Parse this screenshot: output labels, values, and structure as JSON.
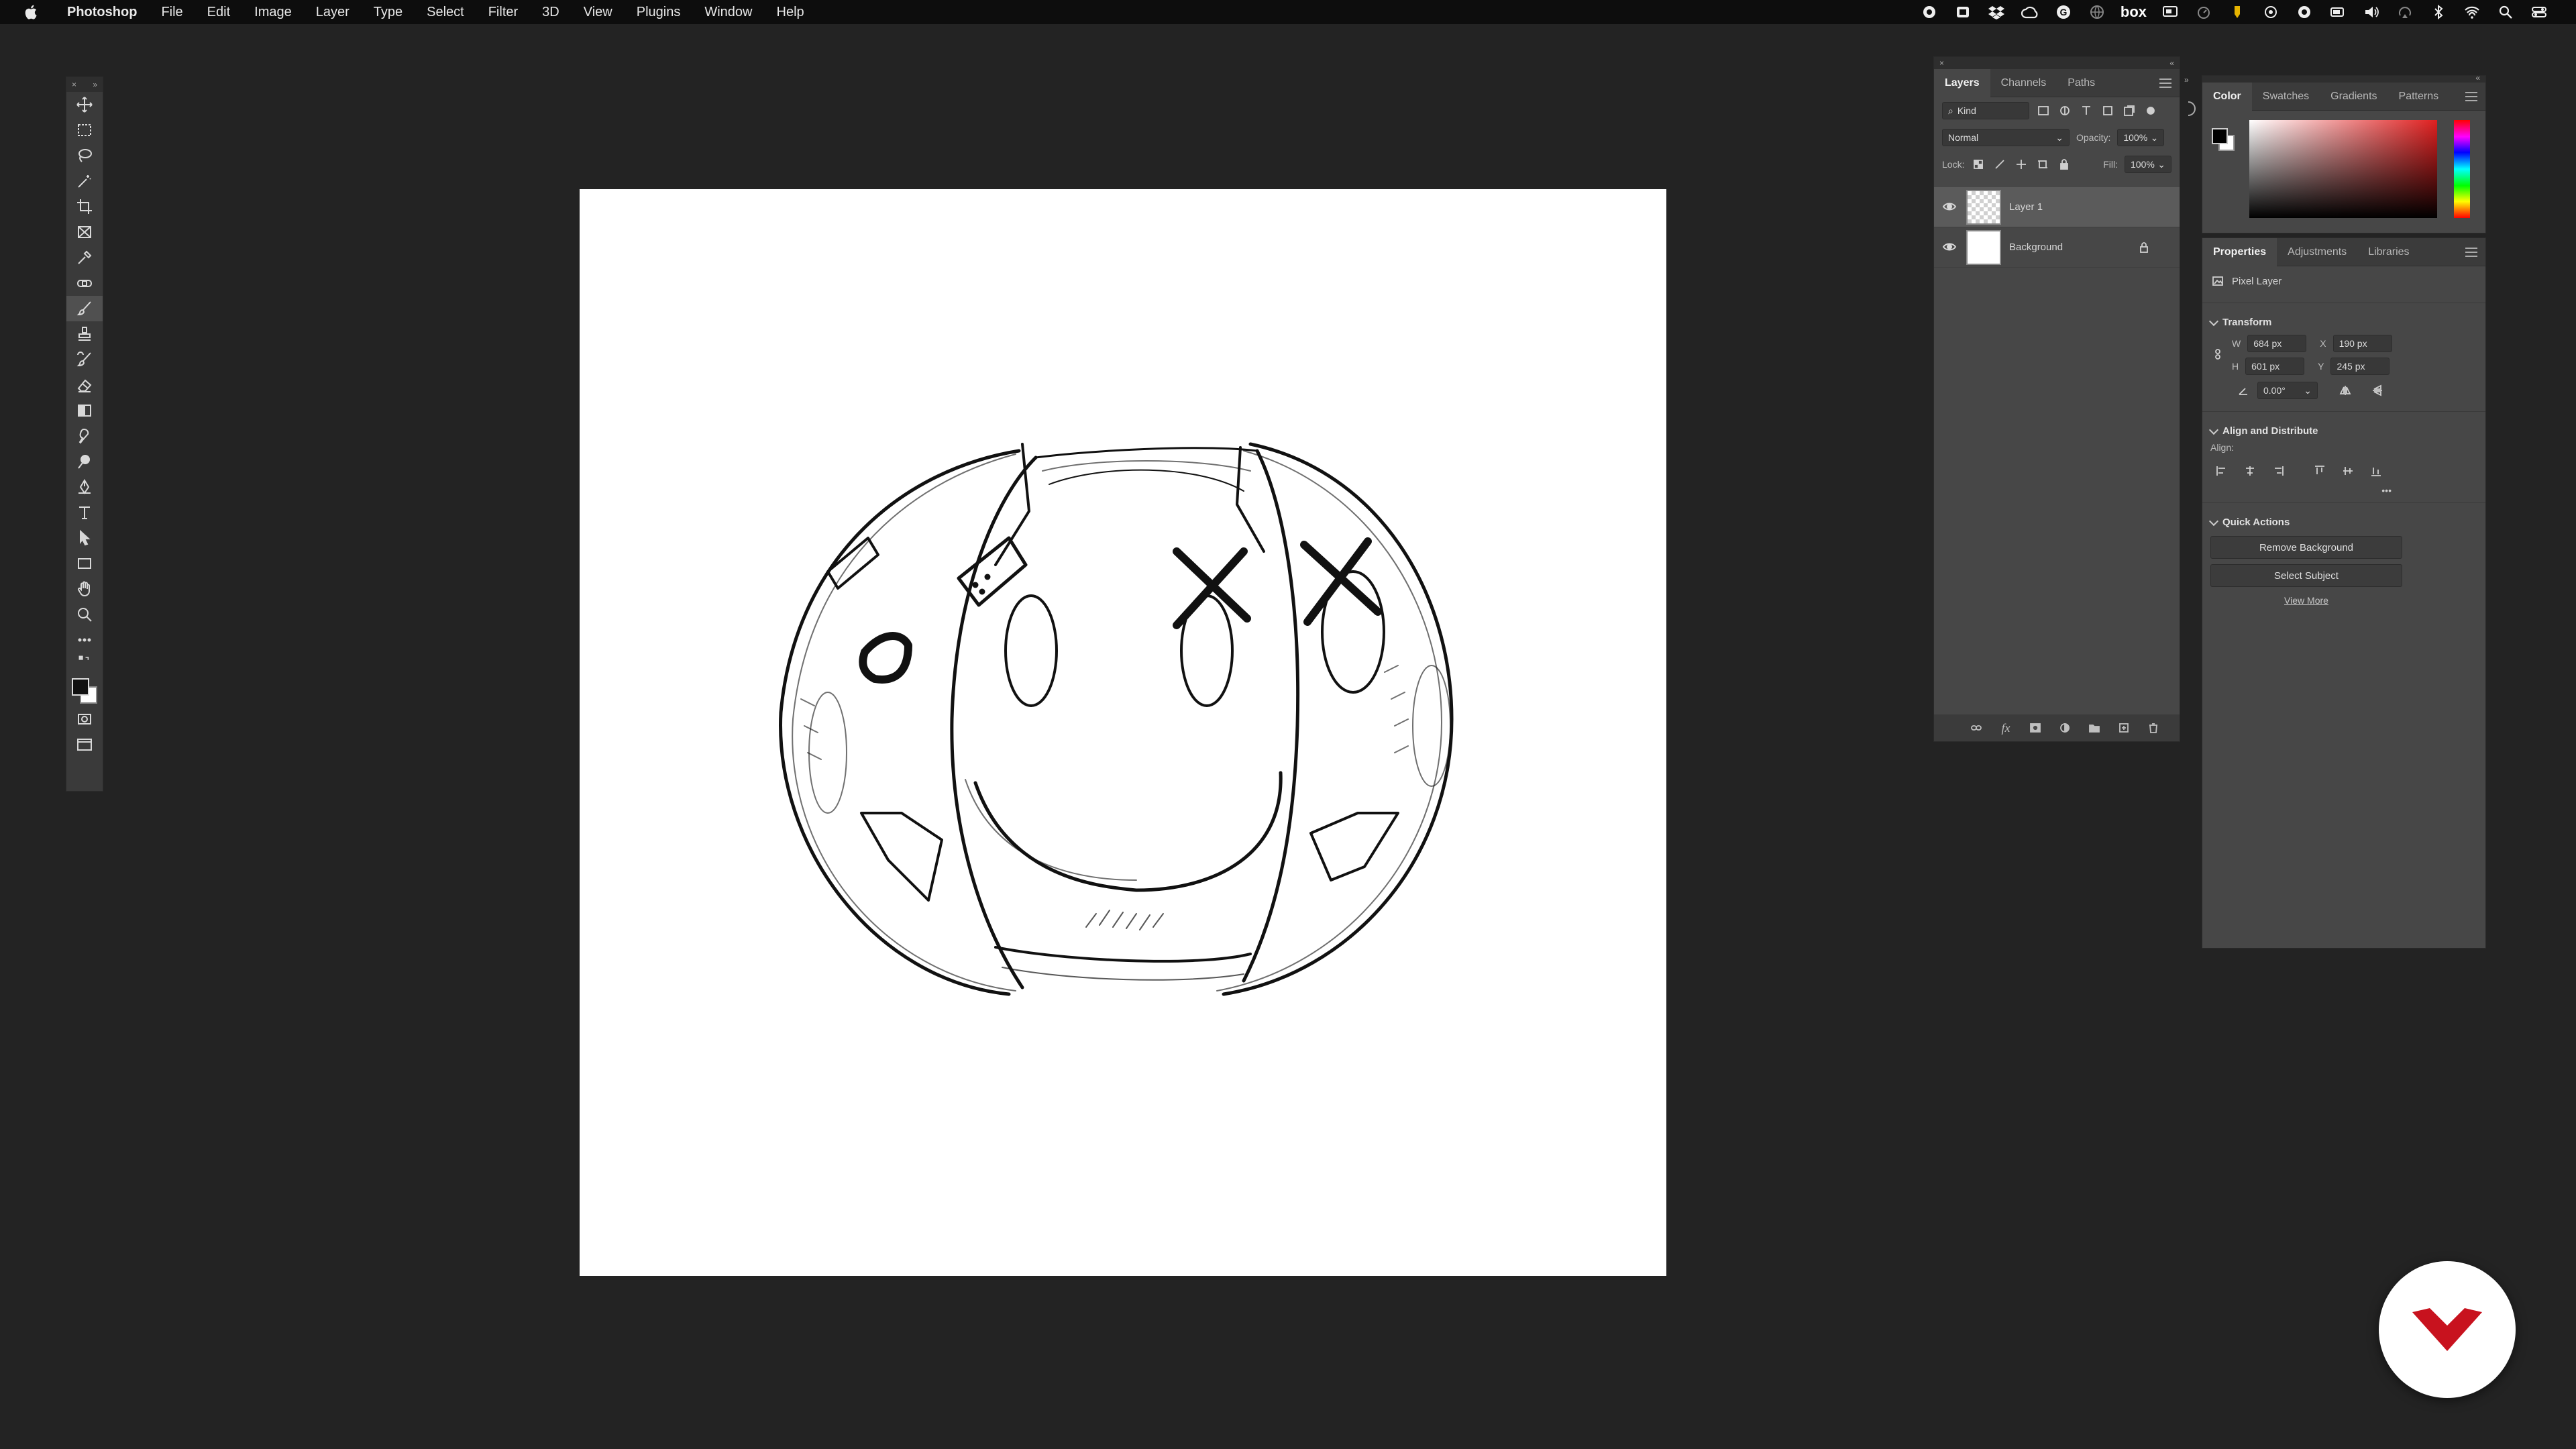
{
  "menubar": {
    "app": "Photoshop",
    "items": [
      "File",
      "Edit",
      "Image",
      "Layer",
      "Type",
      "Select",
      "Filter",
      "3D",
      "View",
      "Plugins",
      "Window",
      "Help"
    ],
    "status_icons": [
      "record-icon",
      "screen-icon",
      "dropbox-icon",
      "creative-cloud-icon",
      "grammarly-icon",
      "globe-icon",
      "box-icon",
      "display-icon",
      "timer-icon",
      "pencil-icon",
      "circle-icon",
      "compass-icon",
      "battery-icon",
      "volume-icon",
      "airplay-icon",
      "bluetooth-icon",
      "wifi-icon",
      "search-icon",
      "control-center-icon"
    ],
    "box_label": "box"
  },
  "layers_panel": {
    "tabs": [
      "Layers",
      "Channels",
      "Paths"
    ],
    "filter_kind": "Kind",
    "blend_mode": "Normal",
    "opacity_label": "Opacity:",
    "opacity_value": "100%",
    "lock_label": "Lock:",
    "fill_label": "Fill:",
    "fill_value": "100%",
    "layers": [
      {
        "name": "Layer 1",
        "selected": true,
        "transparent": true
      },
      {
        "name": "Background",
        "selected": false,
        "locked": true
      }
    ],
    "footer_icons": [
      "link-icon",
      "fx-icon",
      "mask-icon",
      "adjustment-icon",
      "folder-icon",
      "new-layer-icon",
      "trash-icon"
    ]
  },
  "color_panel": {
    "tabs": [
      "Color",
      "Swatches",
      "Gradients",
      "Patterns"
    ]
  },
  "properties_panel": {
    "tabs": [
      "Properties",
      "Adjustments",
      "Libraries"
    ],
    "layer_type": "Pixel Layer",
    "transform_title": "Transform",
    "w_label": "W",
    "w_value": "684 px",
    "x_label": "X",
    "x_value": "190 px",
    "h_label": "H",
    "h_value": "601 px",
    "y_label": "Y",
    "y_value": "245 px",
    "angle_value": "0.00°",
    "align_title": "Align and Distribute",
    "align_label": "Align:",
    "more": "•••",
    "quick_title": "Quick Actions",
    "remove_bg": "Remove Background",
    "select_subject": "Select Subject",
    "view_more": "View More"
  },
  "accent_color": "#c8121e"
}
